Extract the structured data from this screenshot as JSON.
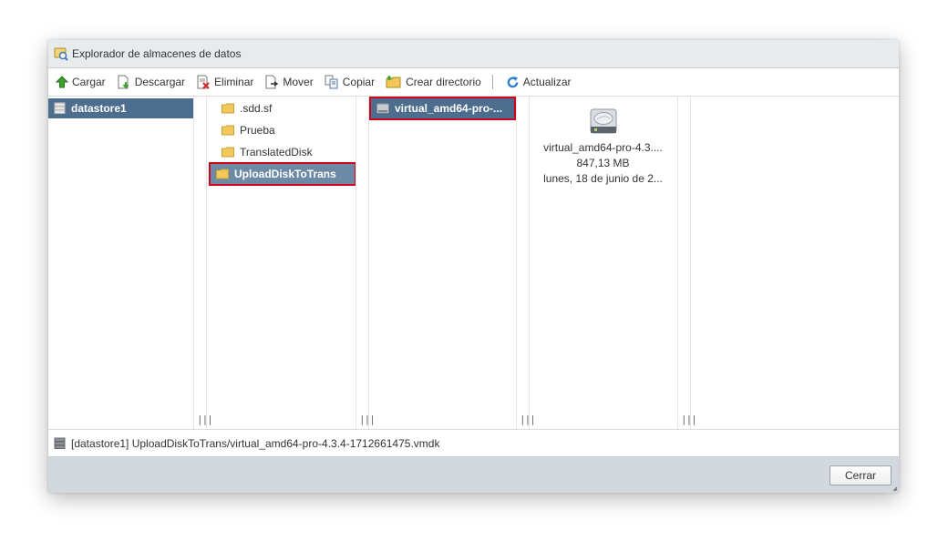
{
  "window": {
    "title": "Explorador de almacenes de datos"
  },
  "toolbar": {
    "upload": "Cargar",
    "download": "Descargar",
    "delete": "Eliminar",
    "move": "Mover",
    "copy": "Copiar",
    "create_dir": "Crear directorio",
    "refresh": "Actualizar"
  },
  "columns": {
    "datastores": [
      "datastore1"
    ],
    "folders": [
      ".sdd.sf",
      "Prueba",
      "TranslatedDisk",
      "UploadDiskToTrans"
    ],
    "files": [
      "virtual_amd64-pro-..."
    ]
  },
  "details": {
    "name": "virtual_amd64-pro-4.3....",
    "size": "847,13 MB",
    "date": "lunes, 18 de junio de 2..."
  },
  "status": {
    "path": "[datastore1] UploadDiskToTrans/virtual_amd64-pro-4.3.4-1712661475.vmdk"
  },
  "footer": {
    "close": "Cerrar"
  },
  "colors": {
    "selection": "#4d6d8f",
    "highlight": "#d0021b",
    "footer_bg": "#d3d8df"
  }
}
